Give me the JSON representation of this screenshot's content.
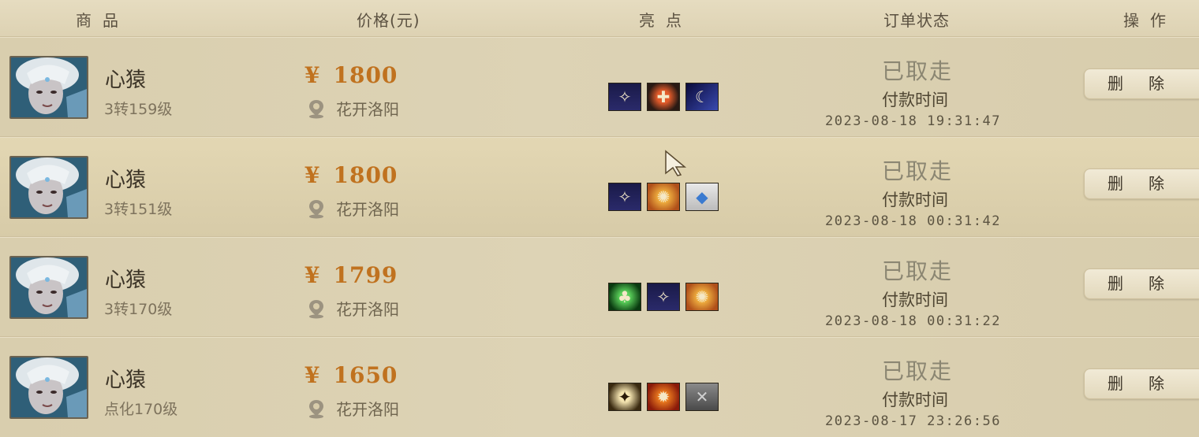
{
  "header": {
    "goods": "商品",
    "price": "价格(元)",
    "highlights": "亮点",
    "status": "订单状态",
    "operation": "操作"
  },
  "rows": [
    {
      "name": "心猿",
      "level": "3转159级",
      "currency": "¥",
      "price": "1800",
      "server": "花开洛阳",
      "status": "已取走",
      "pay_label": "付款时间",
      "pay_time": "2023-08-18 19:31:47",
      "delete_label": "删除",
      "highlights": [
        "skill-icon-a",
        "skill-icon-b",
        "skill-icon-c"
      ]
    },
    {
      "name": "心猿",
      "level": "3转151级",
      "currency": "¥",
      "price": "1800",
      "server": "花开洛阳",
      "status": "已取走",
      "pay_label": "付款时间",
      "pay_time": "2023-08-18 00:31:42",
      "delete_label": "删除",
      "highlights": [
        "skill-icon-a",
        "skill-icon-d",
        "skill-icon-e"
      ]
    },
    {
      "name": "心猿",
      "level": "3转170级",
      "currency": "¥",
      "price": "1799",
      "server": "花开洛阳",
      "status": "已取走",
      "pay_label": "付款时间",
      "pay_time": "2023-08-18 00:31:22",
      "delete_label": "删除",
      "highlights": [
        "skill-icon-f",
        "skill-icon-a",
        "skill-icon-d"
      ]
    },
    {
      "name": "心猿",
      "level": "点化170级",
      "currency": "¥",
      "price": "1650",
      "server": "花开洛阳",
      "status": "已取走",
      "pay_label": "付款时间",
      "pay_time": "2023-08-17 23:26:56",
      "delete_label": "删除",
      "highlights": [
        "skill-icon-g",
        "skill-icon-h",
        "skill-icon-i"
      ]
    }
  ],
  "colors": {
    "background": "#d8ccaa",
    "price": "#c0721f",
    "status": "#8b8672"
  }
}
